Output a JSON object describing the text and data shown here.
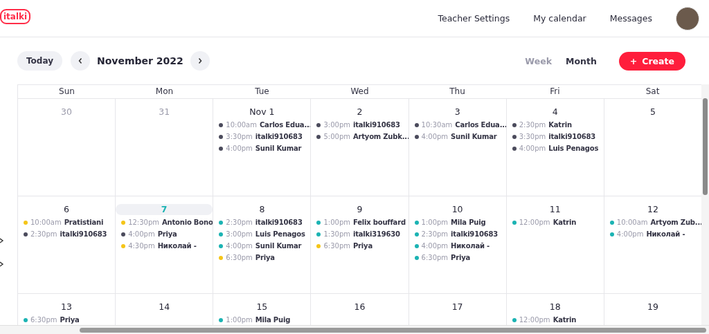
{
  "header": {
    "logo": "italki",
    "nav": [
      "Teacher Settings",
      "My calendar",
      "Messages"
    ]
  },
  "toolbar": {
    "today": "Today",
    "month": "November 2022",
    "views": [
      {
        "label": "Week",
        "selected": false
      },
      {
        "label": "Month",
        "selected": true
      }
    ],
    "create": {
      "icon": "+",
      "label": "Create"
    }
  },
  "weekdays": [
    "Sun",
    "Mon",
    "Tue",
    "Wed",
    "Thu",
    "Fri",
    "Sat"
  ],
  "weeks": [
    [
      {
        "date": "30",
        "kind": "outside"
      },
      {
        "date": "31",
        "kind": "outside"
      },
      {
        "date": "Nov 1",
        "kind": "normal",
        "events": [
          {
            "time": "10:00am",
            "name": "Carlos Edua...",
            "color": "#4b4b5c"
          },
          {
            "time": "3:30pm",
            "name": "italki910683",
            "color": "#4b4b5c"
          },
          {
            "time": "4:00pm",
            "name": "Sunil Kumar",
            "color": "#4b4b5c"
          }
        ]
      },
      {
        "date": "2",
        "kind": "normal",
        "events": [
          {
            "time": "3:00pm",
            "name": "italki910683",
            "color": "#4b4b5c"
          },
          {
            "time": "5:00pm",
            "name": "Artyom Zubk...",
            "color": "#4b4b5c"
          }
        ]
      },
      {
        "date": "3",
        "kind": "normal",
        "events": [
          {
            "time": "10:30am",
            "name": "Carlos Edua...",
            "color": "#4b4b5c"
          },
          {
            "time": "4:00pm",
            "name": "Sunil Kumar",
            "color": "#4b4b5c"
          }
        ]
      },
      {
        "date": "4",
        "kind": "normal",
        "events": [
          {
            "time": "2:30pm",
            "name": "Katrin",
            "color": "#4b4b5c"
          },
          {
            "time": "3:30pm",
            "name": "italki910683",
            "color": "#4b4b5c"
          },
          {
            "time": "4:00pm",
            "name": "Luis Penagos",
            "color": "#4b4b5c"
          }
        ]
      },
      {
        "date": "5",
        "kind": "normal"
      }
    ],
    [
      {
        "date": "6",
        "kind": "normal",
        "events": [
          {
            "time": "10:00am",
            "name": "Pratistiani",
            "color": "#f5c518"
          },
          {
            "time": "2:30pm",
            "name": "italki910683",
            "color": "#4b4b5c"
          }
        ]
      },
      {
        "date": "7",
        "kind": "today",
        "events": [
          {
            "time": "12:30pm",
            "name": "Antonio Bono",
            "color": "#f5c518"
          },
          {
            "time": "4:00pm",
            "name": "Priya",
            "color": "#4b4b5c"
          },
          {
            "time": "4:30pm",
            "name": "Николай -",
            "color": "#f5c518"
          }
        ]
      },
      {
        "date": "8",
        "kind": "normal",
        "events": [
          {
            "time": "2:30pm",
            "name": "italki910683",
            "color": "#1bb3b3"
          },
          {
            "time": "3:00pm",
            "name": "Luis Penagos",
            "color": "#1bb3b3"
          },
          {
            "time": "4:00pm",
            "name": "Sunil Kumar",
            "color": "#1bb3b3"
          },
          {
            "time": "6:30pm",
            "name": "Priya",
            "color": "#f5c518"
          }
        ]
      },
      {
        "date": "9",
        "kind": "normal",
        "events": [
          {
            "time": "1:00pm",
            "name": "Felix bouffard",
            "color": "#1bb3b3"
          },
          {
            "time": "1:30pm",
            "name": "italki319630",
            "color": "#1bb3b3"
          },
          {
            "time": "6:30pm",
            "name": "Priya",
            "color": "#f5c518"
          }
        ]
      },
      {
        "date": "10",
        "kind": "normal",
        "events": [
          {
            "time": "1:00pm",
            "name": "Mila Puig",
            "color": "#1bb3b3"
          },
          {
            "time": "2:30pm",
            "name": "italki910683",
            "color": "#1bb3b3"
          },
          {
            "time": "4:00pm",
            "name": "Николай -",
            "color": "#1bb3b3"
          },
          {
            "time": "6:30pm",
            "name": "Priya",
            "color": "#1bb3b3"
          }
        ]
      },
      {
        "date": "11",
        "kind": "normal",
        "events": [
          {
            "time": "12:00pm",
            "name": "Katrin",
            "color": "#1bb3b3"
          }
        ]
      },
      {
        "date": "12",
        "kind": "normal",
        "events": [
          {
            "time": "10:00am",
            "name": "Artyom Zub...",
            "color": "#1bb3b3"
          },
          {
            "time": "4:00pm",
            "name": "Николай -",
            "color": "#1bb3b3"
          }
        ]
      }
    ],
    [
      {
        "date": "13",
        "kind": "normal",
        "events": [
          {
            "time": "6:30pm",
            "name": "Priya",
            "color": "#1bb3b3"
          }
        ]
      },
      {
        "date": "14",
        "kind": "normal"
      },
      {
        "date": "15",
        "kind": "normal",
        "events": [
          {
            "time": "1:00pm",
            "name": "Mila Puig",
            "color": "#1bb3b3"
          }
        ]
      },
      {
        "date": "16",
        "kind": "normal"
      },
      {
        "date": "17",
        "kind": "normal"
      },
      {
        "date": "18",
        "kind": "normal",
        "events": [
          {
            "time": "12:00pm",
            "name": "Katrin",
            "color": "#1bb3b3"
          }
        ]
      },
      {
        "date": "19",
        "kind": "normal"
      }
    ]
  ]
}
